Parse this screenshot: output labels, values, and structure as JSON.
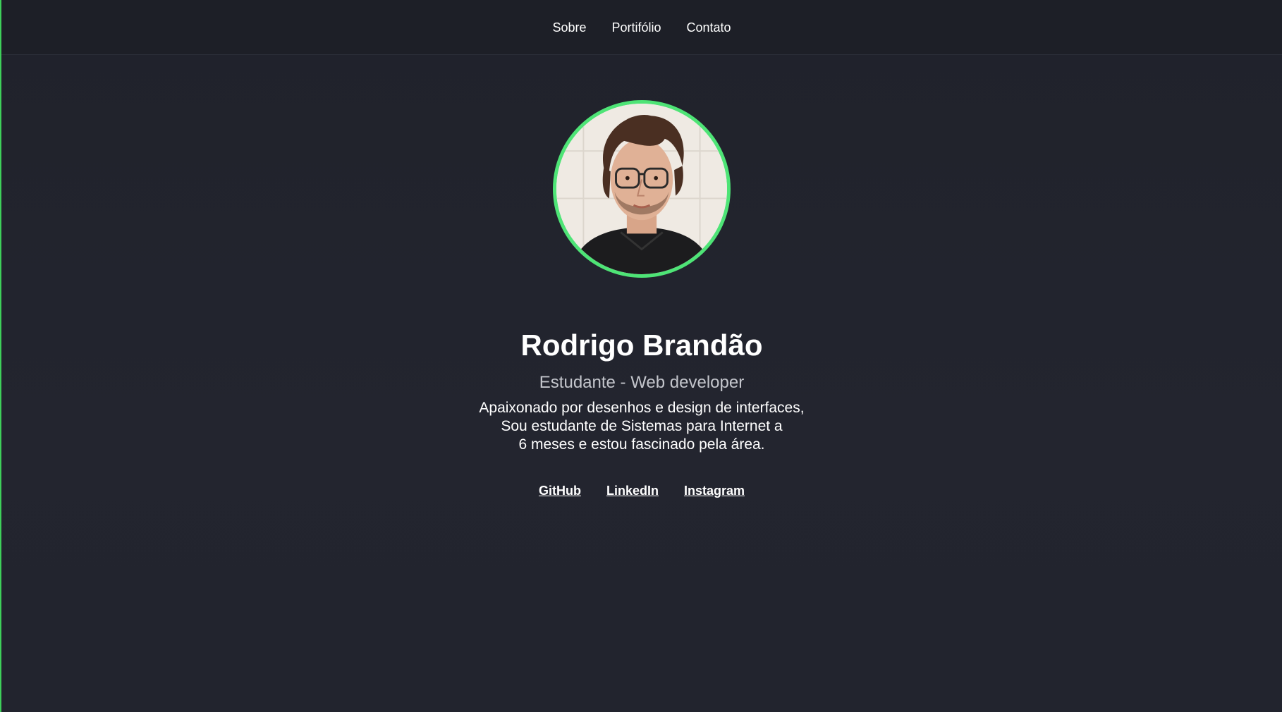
{
  "nav": {
    "items": [
      "Sobre",
      "Portifólio",
      "Contato"
    ]
  },
  "profile": {
    "name": "Rodrigo Brandão",
    "role": "Estudante - Web developer",
    "bio_lines": [
      "Apaixonado por desenhos e design de interfaces,",
      "Sou estudante de Sistemas para Internet a",
      "6 meses e estou fascinado pela área."
    ],
    "avatar_border_color": "#4ee476"
  },
  "social": {
    "links": [
      "GitHub",
      "LinkedIn",
      "Instagram"
    ]
  },
  "colors": {
    "background": "#22242f",
    "accent": "#4ee476",
    "text": "#ffffff",
    "muted": "#c4c6cc"
  }
}
